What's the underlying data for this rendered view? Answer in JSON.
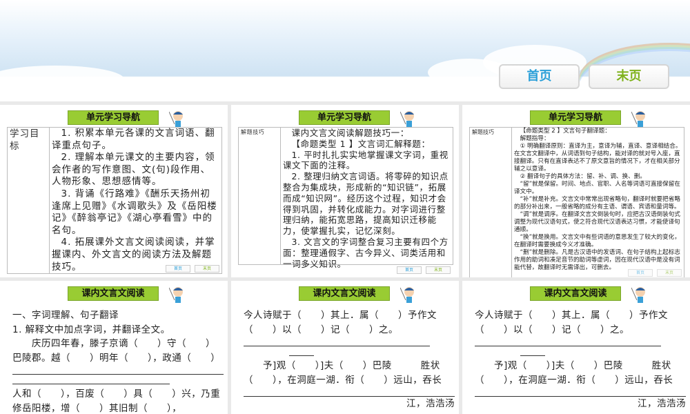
{
  "nav": {
    "first": "首页",
    "last": "末页",
    "first_color": "#2a9fd8",
    "last_color": "#7fb21c"
  },
  "slides": [
    {
      "banner": "单元学习导航",
      "label": "学习目标",
      "items": [
        "1. 积累本单元各课的文言词语、翻译重点句子。",
        "2. 理解本单元课文的主要内容，领会作者的写作意图、文(句)段作用、人物形象、思想感情等。",
        "3. 背诵《行路难》《酬乐天扬州初逢席上见赠》《水调歌头》及《岳阳楼记》《醉翁亭记》《湖心亭看雪》中的名句。",
        "4. 拓展课外文言文阅读阅读，并掌握课内、外文言文的阅读方法及解题技巧。"
      ],
      "first": "首页",
      "last": "末页"
    },
    {
      "banner": "单元学习导航",
      "label": "解题技巧",
      "items": [
        "课内文言文阅读解题技巧一：",
        "【命题类型 1 】文言词汇解释题：",
        "1. 平时扎扎实实地掌握课文字词，重视课文下面的注释。",
        "2. 整理归纳文言词语。将零碎的知识点整合为集成块，形成新的“知识链”，拓展而成“知识网”。经历这个过程，知识才会得到巩固，并转化成能力。对字词进行整理归纳，能拓宽思路，提高知识迁移能力，使掌握扎实，记忆深刻。",
        "3. 文言文的字词整合复习主要有四个方面：整理通假字、古今异义、词类活用和一词多义知识。"
      ],
      "first": "首页",
      "last": "末页"
    },
    {
      "banner": "单元学习导航",
      "label": "解题技巧",
      "items": [
        "【命题类型 2 】文言句子翻译题：",
        "解题指导：",
        "① 明确翻译原则：直译为主，意译为辅，直译、意译相结合。在文言文翻译中，从词语到句子结构，能对译的就对号入座，直接翻译。只有在直译表达不了原文意旨的情况下，才在相关部分辅之以意译。",
        "② 翻译句子的具体方法：留、补、调、换、删。",
        "“留”就是保留。时间、地点、官职、人名等词语可直接保留在译文中。",
        "“补”就是补充。文言文中常常出现省略句，翻译时就要把省略的部分补出来，一般省略的成分有主语、谓语、宾语和量词等。",
        "“调”就是调序。在翻译文言文倒装句时，应把古汉语倒装句式调整为现代汉语句式，使之符合现代汉语表达习惯，才能使译句通顺。",
        "“换”就是换用。文言文中有些词语的意思发生了较大的变化，在翻译时需要换成今义才准确。",
        "“删”就是删除。凡是古汉语中的发语词、在句子结构上起标志作用的助词和凑足音节的助词等虚词，因在现代汉语中是没有词能代替，故翻译时无需译出，可删去。"
      ],
      "first": "首页",
      "last": "末页"
    }
  ],
  "reading": [
    {
      "banner": "课内文言文阅读",
      "lines": [
        "一、字词理解、句子翻译",
        "1. 解释文中加点字词，并翻译全文。",
        "　　庆历四年春，滕子京谪（　　）守（　　）巴陵郡。越（　　）明年（　　），政通（　　）",
        "人和（　　），百废（　　）具（　　）兴，乃重修岳阳楼，增（　　）其旧制（　　），"
      ]
    },
    {
      "banner": "课内文言文阅读",
      "lines": [
        "今人诗赋于（　　）其上．属（　　）予作文（　　）以（　　）记（　　）之。",
        "　　予]观（　　）]夫（　　）巴陵　　　胜状（　　），在洞庭一湖．衔（　　）远山，吞长",
        "江，浩浩汤"
      ]
    },
    {
      "banner": "课内文言文阅读",
      "lines": [
        "今人诗赋于（　　）其上．属（　　）予作文（　　）以（　　）记（　　）之。",
        "　　予]观（　　）]夫（　　）巴陵　　　胜状（　　），在洞庭一湖．衔（　　）远山，吞长",
        "江，浩浩汤"
      ]
    }
  ]
}
